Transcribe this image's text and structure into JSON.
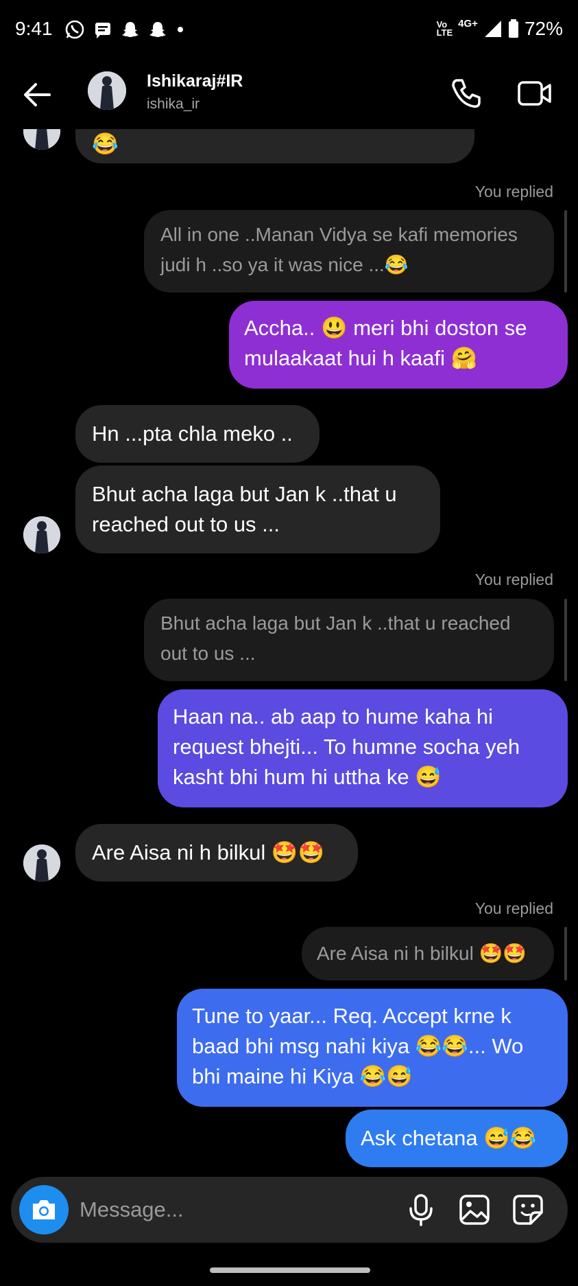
{
  "status_bar": {
    "time": "9:41",
    "volte_label": "Vo \nLTE",
    "network_label": "4G+",
    "signal_label": "R",
    "battery": "72%"
  },
  "header": {
    "name": "Ishikaraj#IR",
    "username": "ishika_ir"
  },
  "messages": [
    {
      "text": "😂"
    },
    {
      "label": "You replied"
    },
    {
      "text": "All in one ..Manan Vidya se kafi memories judi h ..so ya it was nice ...😂"
    },
    {
      "text": "Accha.. 😃 meri bhi doston se mulaakaat hui h kaafi 🤗"
    },
    {
      "text": "Hn ...pta chla meko .."
    },
    {
      "text": "Bhut acha laga but Jan k ..that u reached out to us ..."
    },
    {
      "label": "You replied"
    },
    {
      "text": "Bhut acha laga but Jan k ..that u reached out to us ..."
    },
    {
      "text": "Haan na.. ab aap to hume kaha hi request bhejti... To humne socha yeh kasht bhi hum hi uttha ke 😅"
    },
    {
      "text": "Are Aisa ni h bilkul 🤩🤩"
    },
    {
      "label": "You replied"
    },
    {
      "text": "Are Aisa ni h bilkul 🤩🤩"
    },
    {
      "text": "Tune to yaar... Req. Accept krne k baad bhi msg nahi kiya 😂😂... Wo bhi maine hi Kiya 😂😅"
    },
    {
      "text": "Ask chetana 😅😂"
    }
  ],
  "composer": {
    "placeholder": "Message..."
  },
  "colors": {
    "background": "#000000",
    "incoming_bubble": "#262626",
    "quoted_bubble": "#1c1c1c",
    "outgoing_purple": "#8e2fd4",
    "outgoing_indigo": "#5b4be0",
    "outgoing_blue": "#3d6cef",
    "camera_button": "#1d8ef0"
  },
  "icons": [
    "back-arrow-icon",
    "phone-icon",
    "video-camera-icon",
    "camera-icon",
    "microphone-icon",
    "gallery-icon",
    "sticker-icon",
    "whatsapp-icon",
    "message-icon",
    "snapchat-icon",
    "signal-icon",
    "battery-icon"
  ]
}
